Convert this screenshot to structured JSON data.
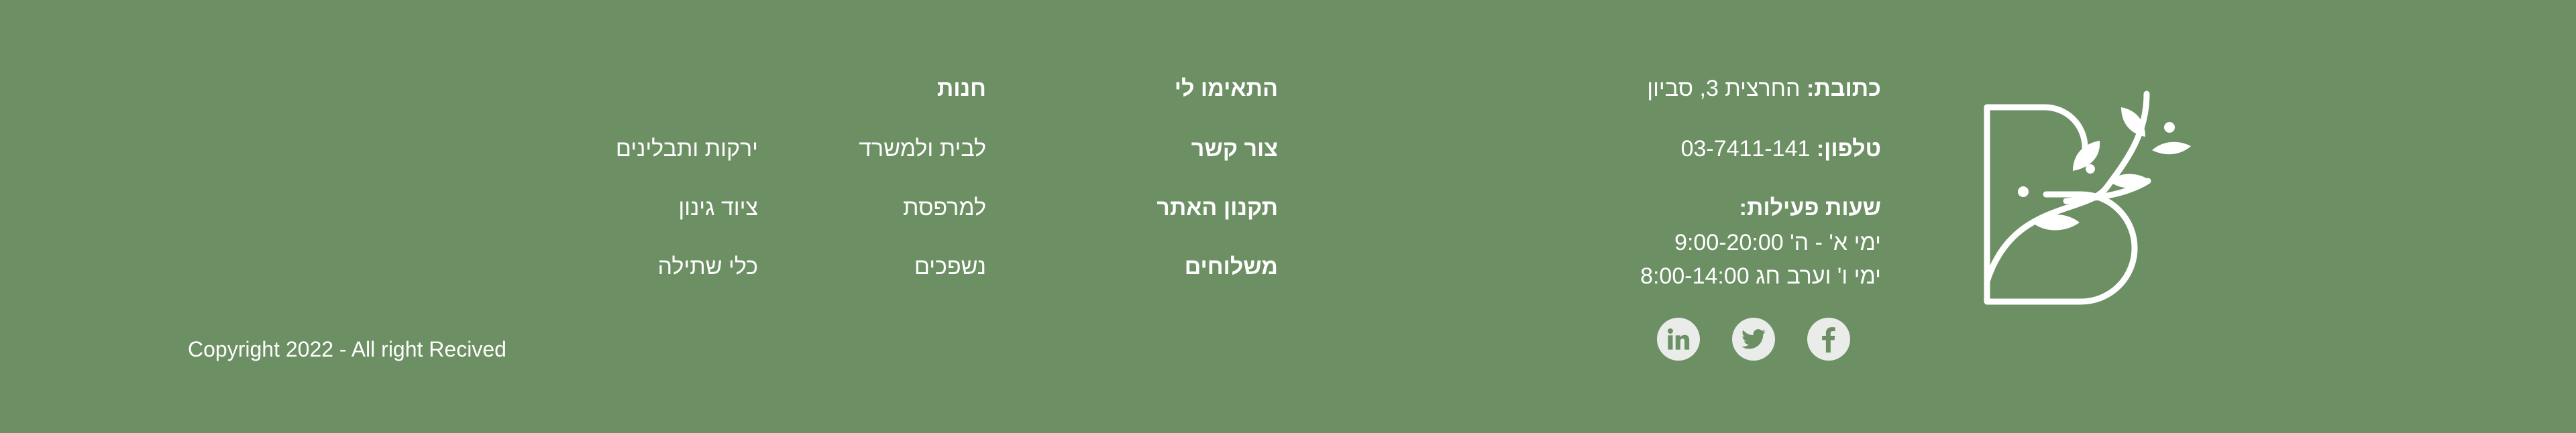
{
  "brand": {
    "logo_icon": "leaf-b-logo-icon"
  },
  "contact": {
    "address_label": "כתובת:",
    "address_value": "החרצית 3, סביון",
    "phone_label": "טלפון:",
    "phone_value": "03-7411-141",
    "hours_label": ":שעות פעילות",
    "hours_line1": "ימי א' - ה' 9:00-20:00",
    "hours_line2": "ימי ו' וערב חג 8:00-14:00"
  },
  "social": [
    {
      "name": "facebook",
      "icon": "facebook-icon"
    },
    {
      "name": "twitter",
      "icon": "twitter-icon"
    },
    {
      "name": "linkedin",
      "icon": "linkedin-icon"
    }
  ],
  "nav": {
    "title": "התאימו לי",
    "items": [
      "צור קשר",
      "תקנון האתר",
      "משלוחים"
    ]
  },
  "shop": {
    "title": "חנות",
    "col1": [
      "לבית ולמשרד",
      "למרפסת",
      "נשפכים"
    ],
    "col2": [
      "ירקות ותבלינים",
      "ציוד גינון",
      "כלי שתילה"
    ]
  },
  "copyright": "Copyright 2022 - All right Recived",
  "colors": {
    "background": "#6c8f63",
    "text": "#ffffff",
    "social_circle": "#e9ece8"
  }
}
